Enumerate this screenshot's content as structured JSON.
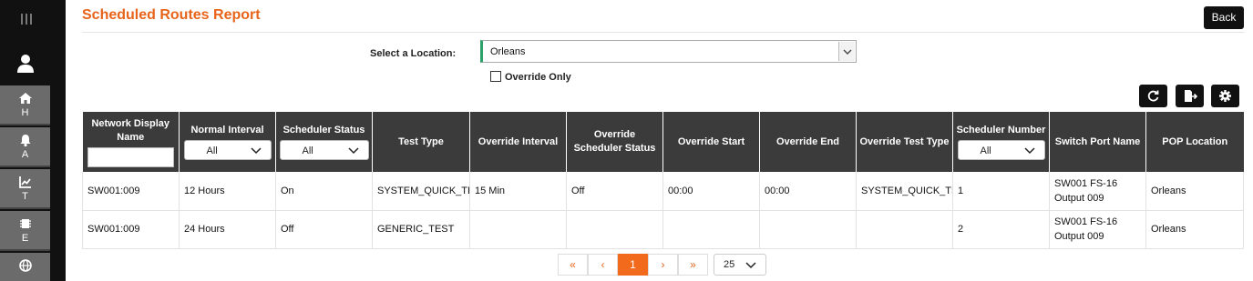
{
  "sidebar": {
    "items": [
      {
        "icon": "home-icon",
        "label": "H"
      },
      {
        "icon": "bell-icon",
        "label": "A"
      },
      {
        "icon": "trend-chart-icon",
        "label": "T"
      },
      {
        "icon": "chip-icon",
        "label": "E"
      },
      {
        "icon": "globe-icon",
        "label": ""
      }
    ]
  },
  "header": {
    "title": "Scheduled Routes Report",
    "back_label": "Back"
  },
  "filters": {
    "location_label": "Select a Location:",
    "location_value": "Orleans",
    "override_only_label": "Override Only",
    "override_only_checked": false
  },
  "table": {
    "columns": [
      "Network Display Name",
      "Normal Interval",
      "Scheduler Status",
      "Test Type",
      "Override Interval",
      "Override Scheduler Status",
      "Override Start",
      "Override End",
      "Override Test Type",
      "Scheduler Number",
      "Switch Port Name",
      "POP Location"
    ],
    "column_filters": {
      "normal_interval": "All",
      "scheduler_status": "All",
      "scheduler_number": "All"
    },
    "rows": [
      [
        "SW001:009",
        "12 Hours",
        "On",
        "SYSTEM_QUICK_TEST",
        "15 Min",
        "Off",
        "00:00",
        "00:00",
        "SYSTEM_QUICK_TEST",
        "1",
        "SW001 FS-16 Output 009",
        "Orleans"
      ],
      [
        "SW001:009",
        "24 Hours",
        "Off",
        "GENERIC_TEST",
        "",
        "",
        "",
        "",
        "",
        "2",
        "SW001 FS-16 Output 009",
        "Orleans"
      ]
    ]
  },
  "pagination": {
    "first": "«",
    "prev": "‹",
    "current": "1",
    "next": "›",
    "last": "»",
    "page_size": "25"
  },
  "colors": {
    "accent": "#e8641b",
    "sidebar_bg": "#111111",
    "sidebar_button": "#6b6b6b",
    "header_bg": "#3b3b3b",
    "location_marker": "#2ca26a"
  }
}
